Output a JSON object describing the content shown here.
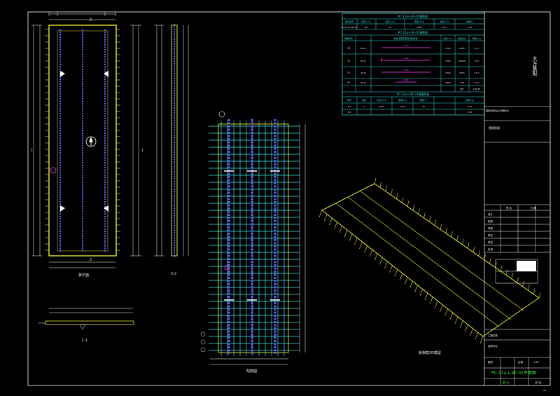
{
  "views": {
    "plan_label": "板平面",
    "side_label": "2-2",
    "section_label": "1-1",
    "rebar_label": "配筋图",
    "iso_label": "板钢筋3D模型"
  },
  "cut_marks": {
    "one": "1",
    "two": "2"
  },
  "table": {
    "title_main": "PC-11a-L-9F-01钢筋表",
    "header": [
      "构件编号",
      "长度(mm)",
      "宽度(mm)",
      "厚度(mm)",
      "体积(m³)",
      "重量(t)"
    ],
    "row1": [
      "PC-11a-L-9F-01",
      "60",
      "70",
      "1800",
      "0.87",
      "2.47"
    ],
    "title_rebar": "PC-11a-L-9F-01钢筋表",
    "rebar_header": [
      "钢筋编号",
      "规格(钢筋直径及钢筋等级)",
      "长度(mm)",
      "根数(根)",
      "重量(kg)"
    ],
    "rebar_rows": [
      {
        "id": "①",
        "spec": "8C10",
        "shape": "1200",
        "len": "4700",
        "num": "6000",
        "wt": "21.7"
      },
      {
        "id": "②",
        "spec": "8C10",
        "shape": "1200",
        "len": "4700",
        "num": "66000",
        "wt": "21.9"
      },
      {
        "id": "③",
        "spec": "2C10",
        "shape": "1200",
        "len": "2700",
        "num": "9600",
        "wt": "21.4"
      },
      {
        "id": "④",
        "spec": "8C10",
        "shape": "2800",
        "len": "2800",
        "num": "230",
        "wt": "21.9"
      }
    ],
    "total_label": "合计",
    "total_value": "166.35",
    "title_embed": "PC-11a-L-9F-01预埋件表",
    "embed_header": [
      "编号",
      "规格",
      "长度(mm)",
      "重量(kg)",
      "数量(个)",
      "总重(kg)"
    ],
    "embed_rows": [
      [
        "M1",
        "2",
        "4000",
        "9.00",
        "16",
        "2.15"
      ],
      [
        "M2",
        "",
        "",
        "",
        "",
        "2.15"
      ]
    ]
  },
  "title_block": {
    "company": "大方集配",
    "note": "图纸说明见设计说明文件",
    "stage": "图纸阶段",
    "header": [
      "签 名",
      "日 期"
    ],
    "roles": [
      "设计",
      "校核",
      "审核",
      "审定",
      "项目",
      "负责"
    ],
    "meta": [
      "工程名称",
      "结构专业"
    ],
    "scale_label": "比例",
    "scale_value": "1:25",
    "sheet_label": "图号",
    "drawing_name": "PC-11a-L-9F-01平面图",
    "page_label": "第1页",
    "page_value": "共1页",
    "corner": "A3"
  },
  "colors": {
    "background": "#000000",
    "outline": "#e6e635",
    "rebar": "#6a5cff",
    "mesh": "#35e6e6",
    "frame": "#ffffff",
    "table_line": "#35e6e6",
    "accent": "#ff40ff"
  }
}
